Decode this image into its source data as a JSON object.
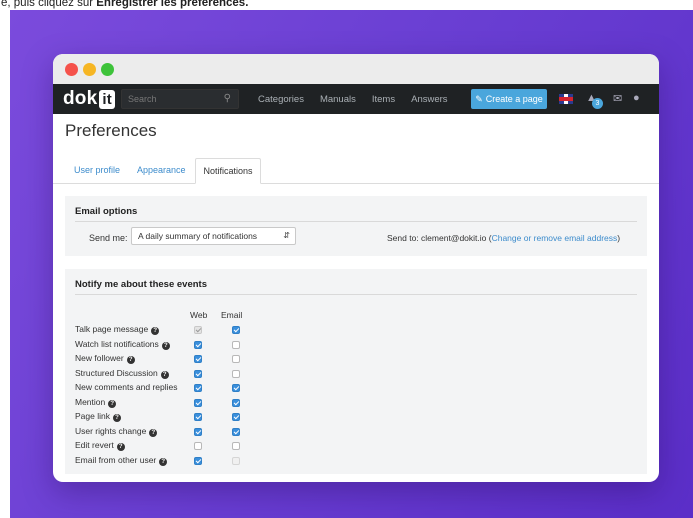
{
  "caption": {
    "prefix": "e, puis cliquez sur ",
    "emph": "Enregistrer les préférences."
  },
  "navbar": {
    "logo_text": "dok",
    "logo_box": "it",
    "search_placeholder": "Search",
    "links": [
      "Categories",
      "Manuals",
      "Items",
      "Answers"
    ],
    "create_label": "Create a page",
    "notification_count": "3"
  },
  "page": {
    "title": "Preferences",
    "tabs": [
      "User profile",
      "Appearance",
      "Notifications"
    ],
    "active_tab": "Notifications"
  },
  "email_options": {
    "title": "Email options",
    "send_me_label": "Send me:",
    "send_me_value": "A daily summary of notifications",
    "send_to_label": "Send to:",
    "send_to_address": "clement@dokit.io",
    "change_link": "Change or remove email address"
  },
  "events": {
    "title": "Notify me about these events",
    "col_web": "Web",
    "col_email": "Email",
    "rows": [
      {
        "label": "Talk page message",
        "help": true,
        "web": true,
        "web_disabled": true,
        "email": true,
        "email_disabled": false
      },
      {
        "label": "Watch list notifications",
        "help": true,
        "web": true,
        "web_disabled": false,
        "email": false,
        "email_disabled": false
      },
      {
        "label": "New follower",
        "help": true,
        "web": true,
        "web_disabled": false,
        "email": false,
        "email_disabled": false
      },
      {
        "label": "Structured Discussion",
        "help": true,
        "web": true,
        "web_disabled": false,
        "email": false,
        "email_disabled": false
      },
      {
        "label": "New comments and replies",
        "help": false,
        "web": true,
        "web_disabled": false,
        "email": true,
        "email_disabled": false
      },
      {
        "label": "Mention",
        "help": true,
        "web": true,
        "web_disabled": false,
        "email": true,
        "email_disabled": false
      },
      {
        "label": "Page link",
        "help": true,
        "web": true,
        "web_disabled": false,
        "email": true,
        "email_disabled": false
      },
      {
        "label": "User rights change",
        "help": true,
        "web": true,
        "web_disabled": false,
        "email": true,
        "email_disabled": false
      },
      {
        "label": "Edit revert",
        "help": true,
        "web": false,
        "web_disabled": false,
        "email": false,
        "email_disabled": false
      },
      {
        "label": "Email from other user",
        "help": true,
        "web": true,
        "web_disabled": false,
        "email": false,
        "email_disabled": true
      }
    ]
  },
  "colors": {
    "background_gradient_start": "#7b4bdc",
    "background_gradient_end": "#5b2ec8",
    "navbar": "#1f2224",
    "accent": "#4aa6dc",
    "checkbox_on": "#3a8fdc",
    "link": "#3d8ccc"
  },
  "icons": {
    "search": "search-icon",
    "create": "pencil-icon",
    "flag": "uk-flag-icon",
    "bell": "bell-icon",
    "mail": "mail-icon",
    "user": "user-icon",
    "help": "question-circle-icon",
    "dropdown": "up-down-chevron-icon"
  }
}
